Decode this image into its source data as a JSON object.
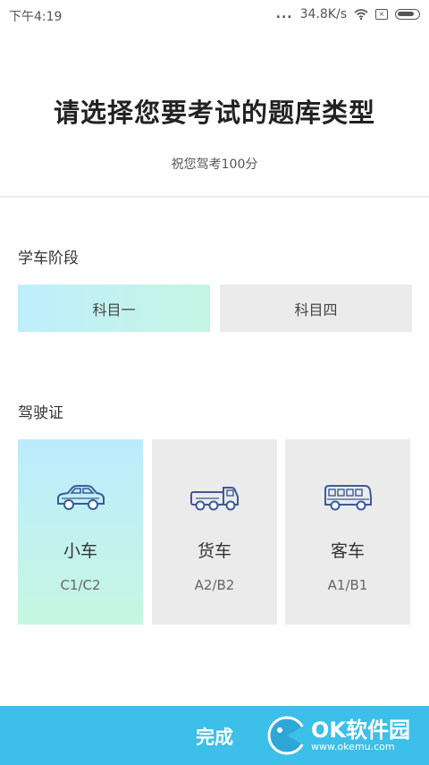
{
  "status_bar": {
    "time": "下午4:19",
    "dots": "...",
    "speed": "34.8K/s",
    "sim": "×",
    "icons": [
      "wifi-icon",
      "sim-icon",
      "battery-icon"
    ]
  },
  "header": {
    "title": "请选择您要考试的题库类型",
    "subtitle": "祝您驾考100分"
  },
  "stage": {
    "label": "学车阶段",
    "options": [
      {
        "label": "科目一",
        "selected": true
      },
      {
        "label": "科目四",
        "selected": false
      }
    ]
  },
  "license": {
    "label": "驾驶证",
    "options": [
      {
        "name": "小车",
        "code": "C1/C2",
        "icon": "car-icon",
        "selected": true
      },
      {
        "name": "货车",
        "code": "A2/B2",
        "icon": "truck-icon",
        "selected": false
      },
      {
        "name": "客车",
        "code": "A1/B1",
        "icon": "bus-icon",
        "selected": false
      }
    ]
  },
  "footer": {
    "done_label": "完成",
    "watermark_main": "OK软件园",
    "watermark_url": "www.okemu.com"
  },
  "colors": {
    "accent": "#3cbfe8",
    "selected_gradient_start": "#bfeefd",
    "selected_gradient_end": "#c6f5e3",
    "unselected": "#ebebeb",
    "icon_stroke": "#3a5a9a"
  }
}
